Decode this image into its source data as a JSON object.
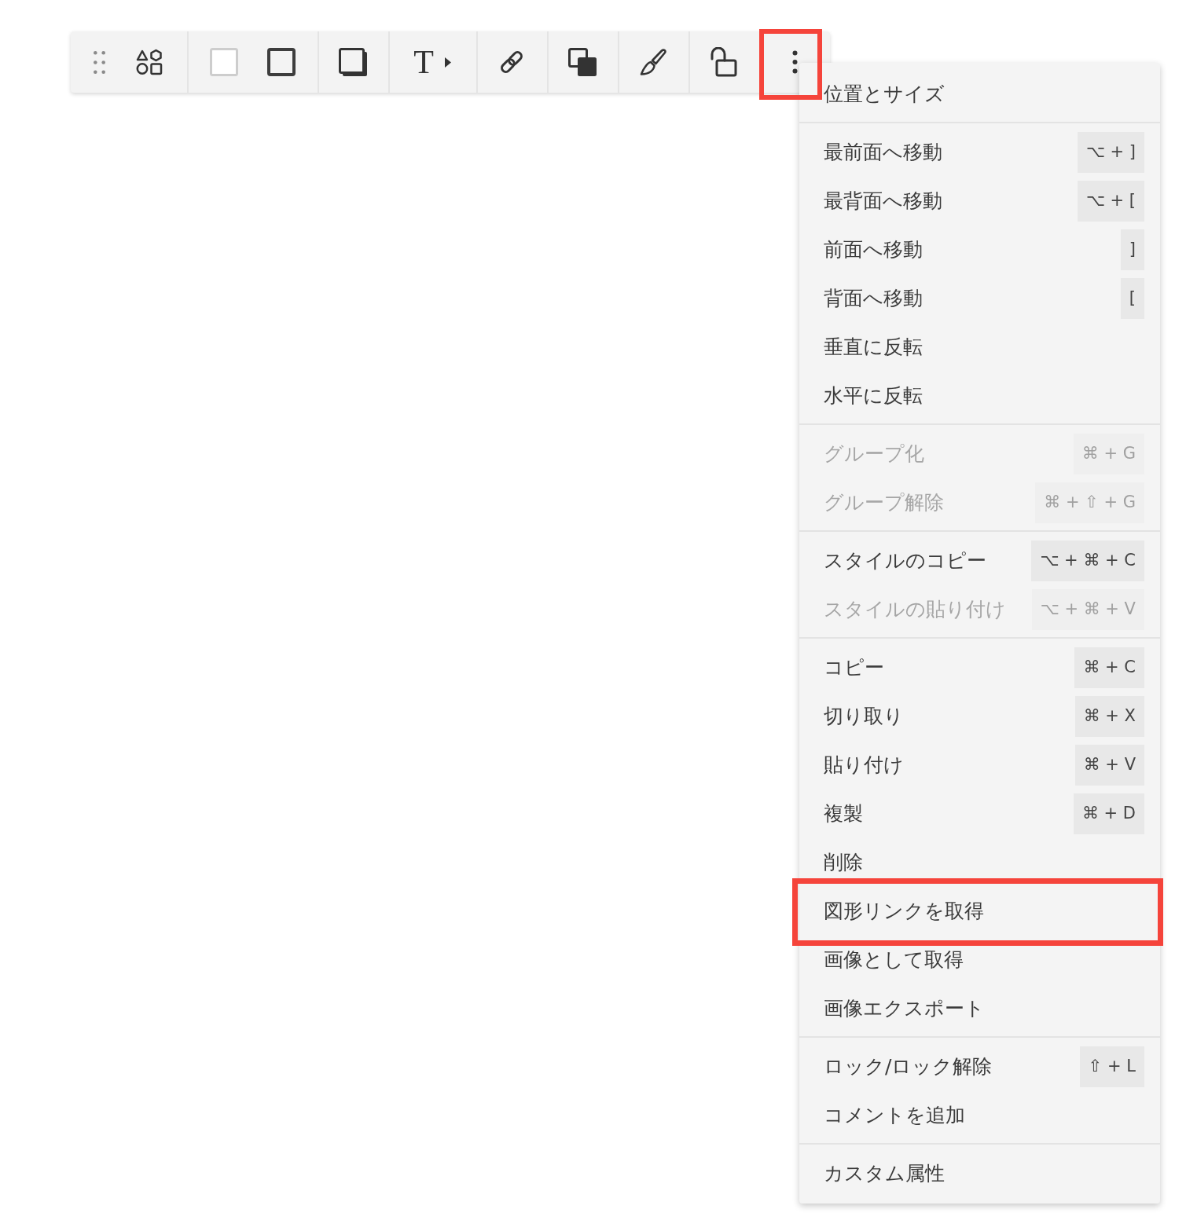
{
  "toolbar": {
    "groups": [
      {
        "tools": [
          {
            "kind": "drag-handle",
            "highlighted": false
          },
          {
            "kind": "shapes",
            "highlighted": false
          }
        ]
      },
      {
        "tools": [
          {
            "kind": "fill",
            "highlighted": false
          },
          {
            "kind": "stroke",
            "highlighted": false
          }
        ]
      },
      {
        "tools": [
          {
            "kind": "shadow",
            "highlighted": false
          }
        ]
      },
      {
        "tools": [
          {
            "kind": "text",
            "label": "T",
            "highlighted": false
          }
        ]
      },
      {
        "tools": [
          {
            "kind": "link",
            "highlighted": false
          }
        ]
      },
      {
        "tools": [
          {
            "kind": "arrange",
            "highlighted": false
          }
        ]
      },
      {
        "tools": [
          {
            "kind": "style",
            "highlighted": false
          }
        ]
      },
      {
        "tools": [
          {
            "kind": "lock",
            "highlighted": false
          }
        ]
      },
      {
        "tools": [
          {
            "kind": "more",
            "highlighted": true
          }
        ]
      }
    ]
  },
  "menu": {
    "sections": [
      {
        "items": [
          {
            "label": "位置とサイズ",
            "disabled": false,
            "highlighted": false
          }
        ]
      },
      {
        "items": [
          {
            "label": "最前面へ移動",
            "shortcut": "⌥ + ]",
            "disabled": false,
            "highlighted": false
          },
          {
            "label": "最背面へ移動",
            "shortcut": "⌥ + [",
            "disabled": false,
            "highlighted": false
          },
          {
            "label": "前面へ移動",
            "shortcut": "]",
            "disabled": false,
            "highlighted": false
          },
          {
            "label": "背面へ移動",
            "shortcut": "[",
            "disabled": false,
            "highlighted": false
          },
          {
            "label": "垂直に反転",
            "disabled": false,
            "highlighted": false
          },
          {
            "label": "水平に反転",
            "disabled": false,
            "highlighted": false
          }
        ]
      },
      {
        "items": [
          {
            "label": "グループ化",
            "shortcut": "⌘ + G",
            "disabled": true,
            "highlighted": false
          },
          {
            "label": "グループ解除",
            "shortcut": "⌘ + ⇧ + G",
            "disabled": true,
            "highlighted": false
          }
        ]
      },
      {
        "items": [
          {
            "label": "スタイルのコピー",
            "shortcut": "⌥ + ⌘ + C",
            "disabled": false,
            "highlighted": false
          },
          {
            "label": "スタイルの貼り付け",
            "shortcut": "⌥ + ⌘ + V",
            "disabled": true,
            "highlighted": false
          }
        ]
      },
      {
        "items": [
          {
            "label": "コピー",
            "shortcut": "⌘ + C",
            "disabled": false,
            "highlighted": false
          },
          {
            "label": "切り取り",
            "shortcut": "⌘ + X",
            "disabled": false,
            "highlighted": false
          },
          {
            "label": "貼り付け",
            "shortcut": "⌘ + V",
            "disabled": false,
            "highlighted": false
          },
          {
            "label": "複製",
            "shortcut": "⌘ + D",
            "disabled": false,
            "highlighted": false
          },
          {
            "label": "削除",
            "disabled": false,
            "highlighted": false
          },
          {
            "label": "図形リンクを取得",
            "disabled": false,
            "highlighted": true
          },
          {
            "label": "画像として取得",
            "disabled": false,
            "highlighted": false
          },
          {
            "label": "画像エクスポート",
            "disabled": false,
            "highlighted": false
          }
        ]
      },
      {
        "items": [
          {
            "label": "ロック/ロック解除",
            "shortcut": "⇧ + L",
            "disabled": false,
            "highlighted": false
          },
          {
            "label": "コメントを追加",
            "disabled": false,
            "highlighted": false
          }
        ]
      },
      {
        "items": [
          {
            "label": "カスタム属性",
            "disabled": false,
            "highlighted": false
          }
        ]
      }
    ]
  }
}
